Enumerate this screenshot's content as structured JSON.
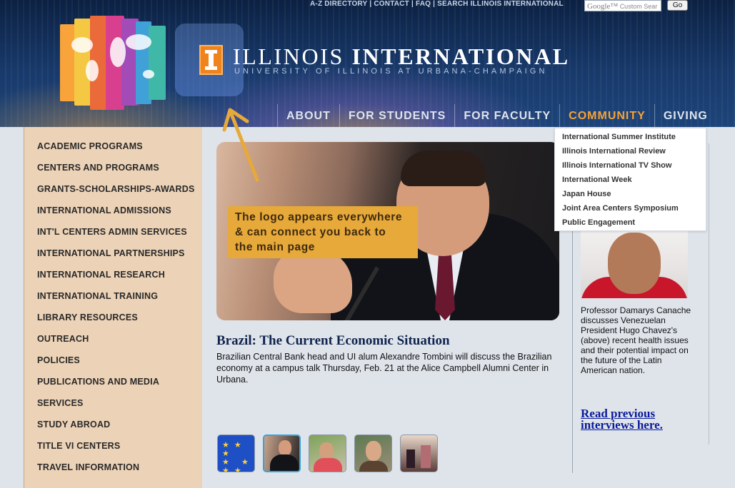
{
  "header": {
    "utility_links": [
      "A-Z DIRECTORY",
      "CONTACT",
      "FAQ",
      "SEARCH ILLINOIS INTERNATIONAL"
    ],
    "search_placeholder": "Custom Sear",
    "search_brand": "Google™",
    "go_label": "Go",
    "brand_title_part1": "ILLINOIS",
    "brand_title_part2": "INTERNATIONAL",
    "brand_subtitle": "UNIVERSITY OF ILLINOIS AT URBANA-CHAMPAIGN"
  },
  "main_nav": [
    {
      "label": "ABOUT",
      "active": false
    },
    {
      "label": "FOR STUDENTS",
      "active": false
    },
    {
      "label": "FOR FACULTY",
      "active": false
    },
    {
      "label": "COMMUNITY",
      "active": true
    },
    {
      "label": "GIVING",
      "active": false
    }
  ],
  "community_menu": [
    "International Summer Institute",
    "Illinois International Review",
    "Illinois International TV Show",
    "International Week",
    "Japan House",
    "Joint Area Centers Symposium",
    "Public Engagement"
  ],
  "sidebar": [
    "ACADEMIC PROGRAMS",
    "CENTERS AND PROGRAMS",
    "GRANTS-SCHOLARSHIPS-AWARDS",
    "INTERNATIONAL ADMISSIONS",
    "INT'L CENTERS ADMIN SERVICES",
    "INTERNATIONAL PARTNERSHIPS",
    "INTERNATIONAL RESEARCH",
    "INTERNATIONAL TRAINING",
    "LIBRARY RESOURCES",
    "OUTREACH",
    "POLICIES",
    "PUBLICATIONS AND MEDIA",
    "SERVICES",
    "STUDY ABROAD",
    "TITLE VI CENTERS",
    "TRAVEL INFORMATION"
  ],
  "callout": {
    "line1": "The logo appears everywhere",
    "line2": "& can connect you back to",
    "line3": "the main page"
  },
  "feature": {
    "headline": "Brazil: The Current Economic Situation",
    "summary": "Brazilian Central Bank head and UI alum Alexandre Tombini will discuss the Brazilian economy at a campus talk Thursday, Feb. 21 at the Alice Campbell Alumni Center in Urbana."
  },
  "profile": {
    "caption": "Professor Damarys Canache discusses Venezuelan President Hugo Chavez's (above) recent health issues and their potential impact on the future of the Latin American nation.",
    "link": "Read previous interviews here."
  },
  "colors": {
    "accent_orange": "#f7a235",
    "callout": "#e6a93a",
    "sidebar_bg": "#ecd2b6",
    "link_blue": "#0a1a9a"
  }
}
